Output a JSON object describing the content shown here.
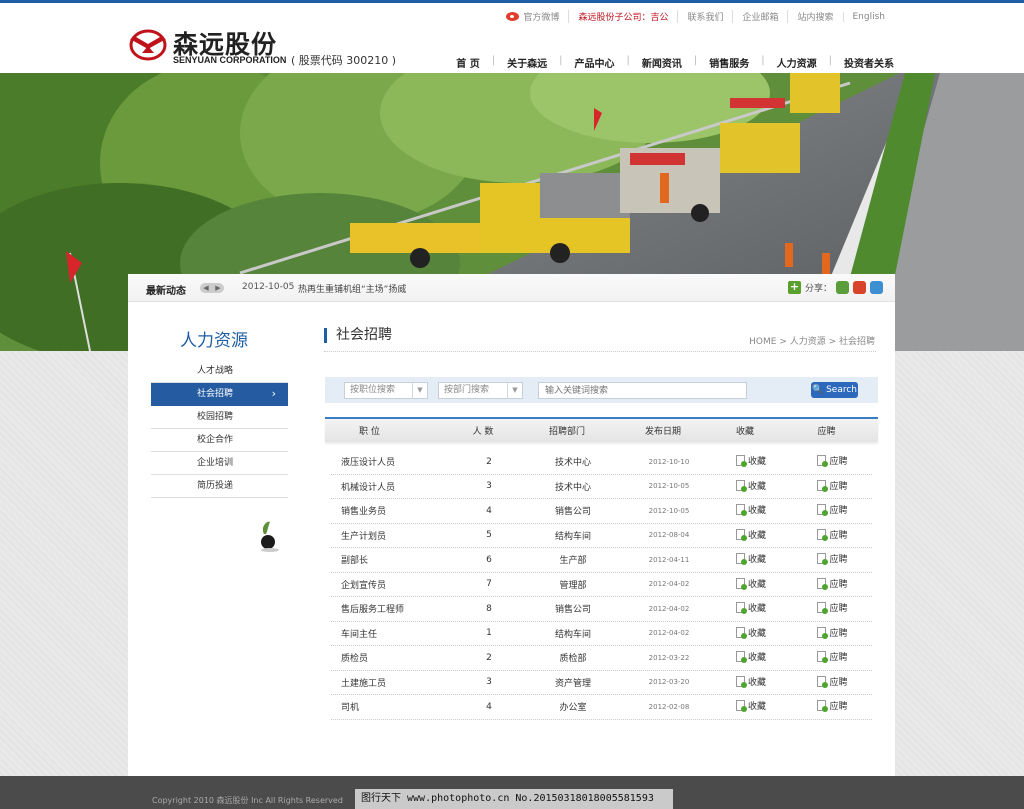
{
  "header": {
    "logo_cn": "森远股份",
    "logo_en": "SENYUAN CORPORATION",
    "stock_code": "( 股票代码 300210 )",
    "top_links": [
      "官方微博",
      "森远股份子公司：吉公",
      "联系我们",
      "企业邮箱",
      "站内搜索",
      "English"
    ],
    "nav": [
      "首 页",
      "关于森远",
      "产品中心",
      "新闻资讯",
      "销售服务",
      "人力资源",
      "投资者关系"
    ]
  },
  "ticker": {
    "label": "最新动态",
    "date": "2012-10-05",
    "text": "热再生重铺机组“主场”扬威",
    "share_label": "分享："
  },
  "sidebar": {
    "title": "人力资源",
    "items": [
      "人才战略",
      "社会招聘",
      "校园招聘",
      "校企合作",
      "企业培训",
      "简历投递"
    ],
    "active_index": 1
  },
  "main": {
    "title": "社会招聘",
    "breadcrumb": "HOME > 人力资源 > 社会招聘",
    "search": {
      "position_select": "按职位搜索",
      "dept_select": "按部门搜索",
      "keyword_placeholder": "输入关键词搜索",
      "button": "Search"
    },
    "table": {
      "headers": [
        "职 位",
        "人 数",
        "招聘部门",
        "发布日期",
        "收藏",
        "应聘"
      ],
      "rows": [
        {
          "title": "液压设计人员",
          "count": "2",
          "dept": "技术中心",
          "date": "2012-10-10",
          "fav": "收藏",
          "apply": "应聘"
        },
        {
          "title": "机械设计人员",
          "count": "3",
          "dept": "技术中心",
          "date": "2012-10-05",
          "fav": "收藏",
          "apply": "应聘"
        },
        {
          "title": "销售业务员",
          "count": "4",
          "dept": "销售公司",
          "date": "2012-10-05",
          "fav": "收藏",
          "apply": "应聘"
        },
        {
          "title": "生产计划员",
          "count": "5",
          "dept": "结构车间",
          "date": "2012-08-04",
          "fav": "收藏",
          "apply": "应聘"
        },
        {
          "title": "副部长",
          "count": "6",
          "dept": "生产部",
          "date": "2012-04-11",
          "fav": "收藏",
          "apply": "应聘"
        },
        {
          "title": "企划宣传员",
          "count": "7",
          "dept": "管理部",
          "date": "2012-04-02",
          "fav": "收藏",
          "apply": "应聘"
        },
        {
          "title": "售后服务工程师",
          "count": "8",
          "dept": "销售公司",
          "date": "2012-04-02",
          "fav": "收藏",
          "apply": "应聘"
        },
        {
          "title": "车间主任",
          "count": "1",
          "dept": "结构车间",
          "date": "2012-04-02",
          "fav": "收藏",
          "apply": "应聘"
        },
        {
          "title": "质检员",
          "count": "2",
          "dept": "质检部",
          "date": "2012-03-22",
          "fav": "收藏",
          "apply": "应聘"
        },
        {
          "title": "土建施工员",
          "count": "3",
          "dept": "资产管理",
          "date": "2012-03-20",
          "fav": "收藏",
          "apply": "应聘"
        },
        {
          "title": "司机",
          "count": "4",
          "dept": "办公室",
          "date": "2012-02-08",
          "fav": "收藏",
          "apply": "应聘"
        }
      ]
    }
  },
  "footer": {
    "copyright": "Copyright 2010 森远股份 Inc All Rights Reserved",
    "watermark": "图行天下 www.photophoto.cn No.20150318018005581593"
  },
  "colors": {
    "brand_blue": "#1d5ea6",
    "active_menu": "#255ba0",
    "logo_red": "#c0121b",
    "footer_bg": "#4b4b4b"
  }
}
